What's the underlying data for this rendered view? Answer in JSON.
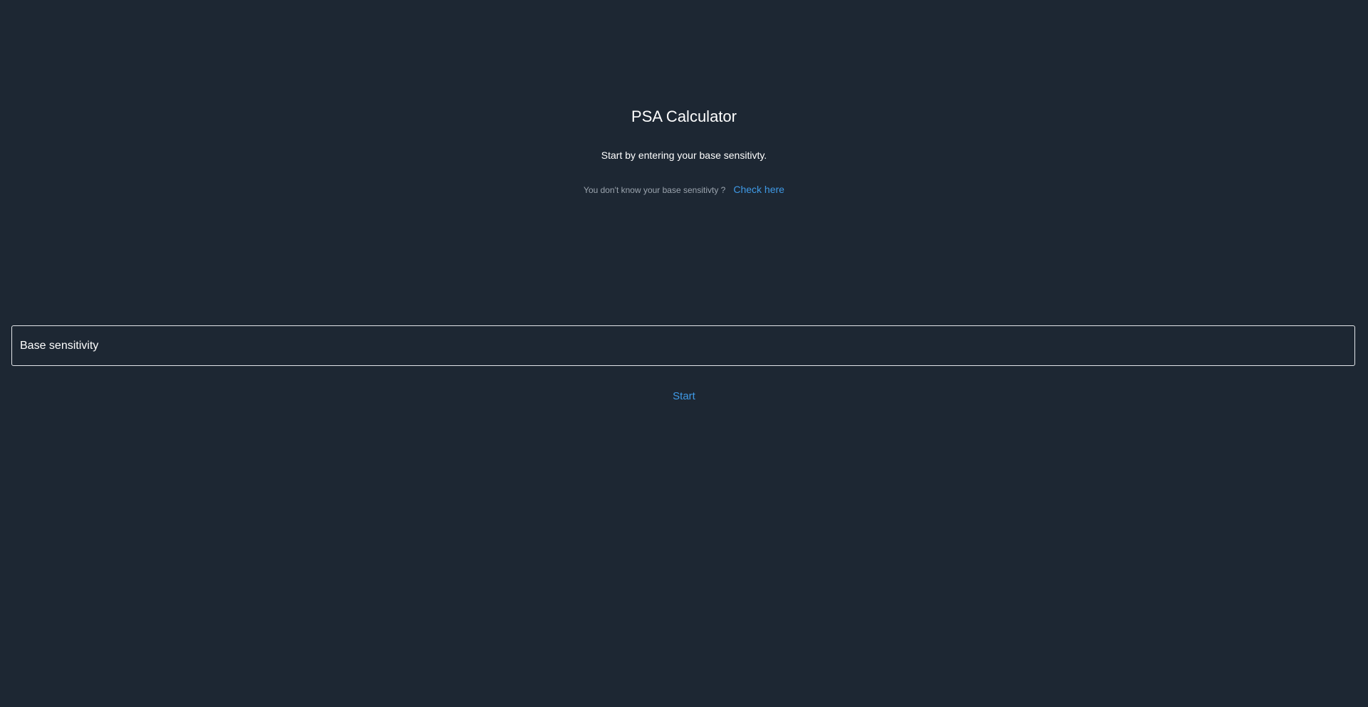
{
  "header": {
    "title": "PSA Calculator",
    "subtitle": "Start by entering your base sensitivty."
  },
  "help": {
    "question": "You don't know your base sensitivty ?",
    "link_label": "Check here"
  },
  "form": {
    "base_sensitivity": {
      "placeholder": "Base sensitivity",
      "value": ""
    },
    "start_label": "Start"
  },
  "colors": {
    "background": "#1d2733",
    "accent": "#3f9ae6",
    "muted_text": "#9ba4ae",
    "input_border": "#e3e6ea"
  }
}
